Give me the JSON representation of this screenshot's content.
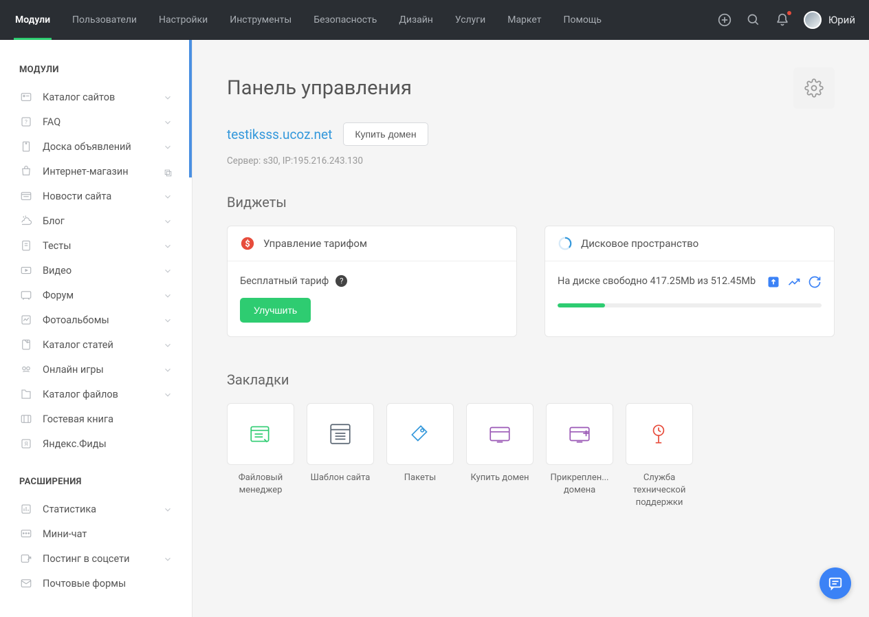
{
  "topnav": {
    "items": [
      "Модули",
      "Пользователи",
      "Настройки",
      "Инструменты",
      "Безопасность",
      "Дизайн",
      "Услуги",
      "Маркет",
      "Помощь"
    ],
    "active_index": 0,
    "username": "Юрий"
  },
  "sidebar": {
    "heading_modules": "МОДУЛИ",
    "heading_extensions": "РАСШИРЕНИЯ",
    "modules": [
      {
        "label": "Каталог сайтов",
        "chevron": true
      },
      {
        "label": "FAQ",
        "chevron": true
      },
      {
        "label": "Доска объявлений",
        "chevron": true
      },
      {
        "label": "Интернет-магазин",
        "chevron": false,
        "external": true
      },
      {
        "label": "Новости сайта",
        "chevron": true
      },
      {
        "label": "Блог",
        "chevron": true
      },
      {
        "label": "Тесты",
        "chevron": true
      },
      {
        "label": "Видео",
        "chevron": true
      },
      {
        "label": "Форум",
        "chevron": true
      },
      {
        "label": "Фотоальбомы",
        "chevron": true
      },
      {
        "label": "Каталог статей",
        "chevron": true
      },
      {
        "label": "Онлайн игры",
        "chevron": true
      },
      {
        "label": "Каталог файлов",
        "chevron": true
      },
      {
        "label": "Гостевая книга",
        "chevron": false
      },
      {
        "label": "Яндекс.Фиды",
        "chevron": false
      }
    ],
    "extensions": [
      {
        "label": "Статистика",
        "chevron": true
      },
      {
        "label": "Мини-чат",
        "chevron": false
      },
      {
        "label": "Постинг в соцсети",
        "chevron": true
      },
      {
        "label": "Почтовые формы",
        "chevron": false
      }
    ]
  },
  "main": {
    "page_title": "Панель управления",
    "domain": "testiksss.ucoz.net",
    "buy_domain_btn": "Купить домен",
    "server_info": "Сервер: s30, IP:195.216.243.130",
    "widgets_title": "Виджеты",
    "tariff_widget": {
      "title": "Управление тарифом",
      "current_label": "Бесплатный тариф",
      "improve_btn": "Улучшить"
    },
    "disk_widget": {
      "title": "Дисковое пространство",
      "text": "На диске свободно 417.25Mb из 512.45Mb",
      "free_mb": 417.25,
      "total_mb": 512.45,
      "percent_used": 18
    },
    "bookmarks_title": "Закладки",
    "bookmarks": [
      {
        "label": "Файловый менеджер",
        "color": "#2ecc71"
      },
      {
        "label": "Шаблон сайта",
        "color": "#5a6673"
      },
      {
        "label": "Пакеты",
        "color": "#3498db"
      },
      {
        "label": "Купить домен",
        "color": "#9b59b6"
      },
      {
        "label": "Прикреплен... домена",
        "color": "#9b59b6"
      },
      {
        "label": "Служба технической поддержки",
        "color": "#e74c3c"
      }
    ]
  }
}
